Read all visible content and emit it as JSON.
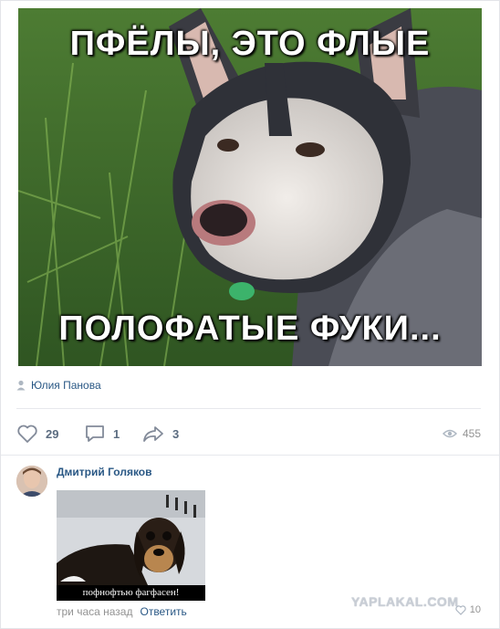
{
  "post": {
    "image_caption_top": "ПФЁЛЫ, ЭТО ФЛЫЕ",
    "image_caption_bottom": "ПОЛОФАТЫЕ ФУКИ...",
    "author": "Юлия Панова",
    "likes": "29",
    "comments": "1",
    "shares": "3",
    "views": "455"
  },
  "comment": {
    "author": "Дмитрий Голяков",
    "attachment_caption": "пофнофтью фагфасен!",
    "time": "три часа назад",
    "reply_label": "Ответить",
    "likes": "10"
  },
  "watermark": "YAPLAKAL.COM",
  "colors": {
    "link": "#2a5885",
    "muted": "#939393",
    "action": "#5b6c80"
  }
}
